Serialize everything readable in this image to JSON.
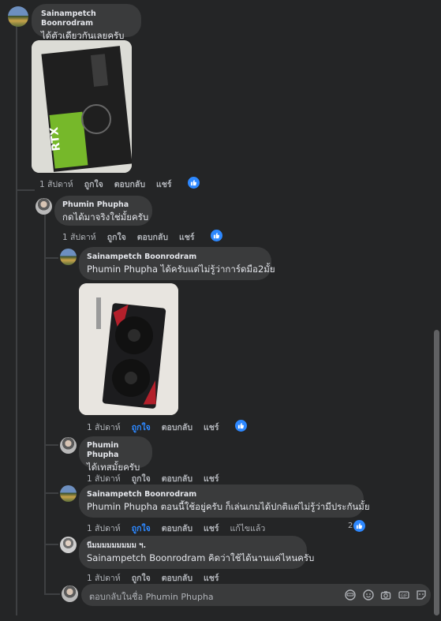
{
  "comments": [
    {
      "author": "Sainampetch Boonrodram",
      "text": "ได้ตัวเดียวกันเลยครับ",
      "image": "rtx-graphics-card-box-photo",
      "actions": {
        "time": "1 สัปดาห์",
        "like": "ถูกใจ",
        "reply": "ตอบกลับ",
        "share": "แชร์"
      },
      "like_count": ""
    },
    {
      "author": "Phumin Phupha",
      "text": "กดได้มาจริงใช่มั้ยครับ",
      "actions": {
        "time": "1 สัปดาห์",
        "like": "ถูกใจ",
        "reply": "ตอบกลับ",
        "share": "แชร์"
      }
    },
    {
      "author": "Sainampetch Boonrodram",
      "text": "Phumin Phupha ได้ครับแต่ไม่รู้ว่าการ์ดมือ2มั้ย",
      "image": "dual-fan-graphics-card-photo",
      "actions": {
        "time": "1 สัปดาห์",
        "like": "ถูกใจ",
        "reply": "ตอบกลับ",
        "share": "แชร์"
      }
    },
    {
      "author": "Phumin Phupha",
      "text": "ได้เทสมั้ยครับ",
      "actions": {
        "time": "1 สัปดาห์",
        "like": "ถูกใจ",
        "reply": "ตอบกลับ",
        "share": "แชร์"
      }
    },
    {
      "author": "Sainampetch Boonrodram",
      "text": "Phumin Phupha ตอนนี้ใช้อยู่ครับ ก็เล่นเกมได้ปกติแต่ไม่รู้ว่ามีประกันมั้ย",
      "actions": {
        "time": "1 สัปดาห์",
        "like": "ถูกใจ",
        "reply": "ตอบกลับ",
        "share": "แชร์",
        "edited": "แก้ไขแล้ว"
      },
      "like_count": "2"
    },
    {
      "author": "นีมมมมมมมมม ฯ.",
      "text": "Sainampetch Boonrodram คิดว่าใช้ได้นานแค่ไหนครับ",
      "actions": {
        "time": "1 สัปดาห์",
        "like": "ถูกใจ",
        "reply": "ตอบกลับ",
        "share": "แชร์"
      }
    }
  ],
  "reply_box": {
    "placeholder": "ตอบกลับในชื่อ Phumin Phupha",
    "icons": [
      "emoji-icon",
      "sticker-smile-icon",
      "camera-icon",
      "gif-icon",
      "sticker-icon"
    ]
  },
  "colors": {
    "background": "#242526",
    "bubble": "#3a3b3c",
    "accent": "#2d88ff",
    "muted": "#b0b3b8"
  }
}
